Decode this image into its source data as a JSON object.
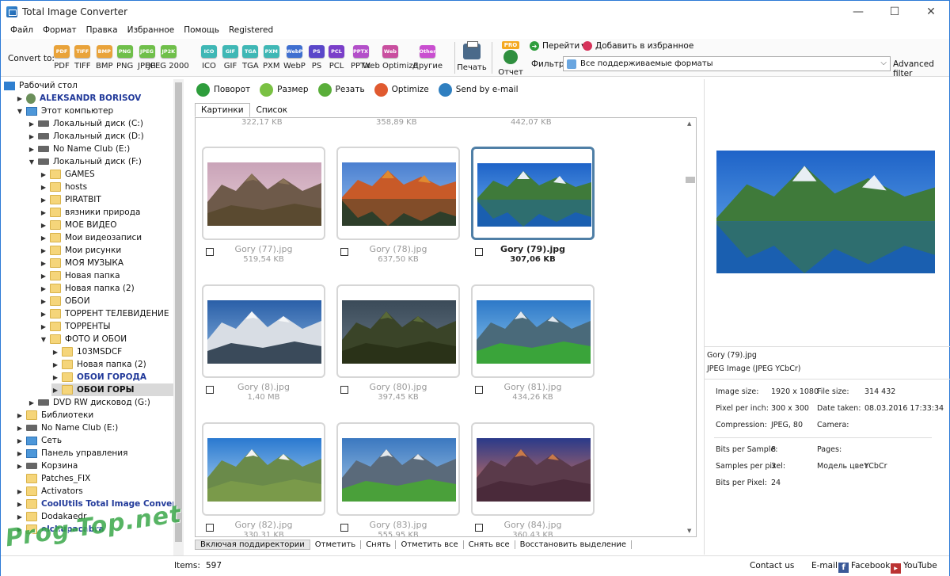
{
  "window": {
    "title": "Total Image Converter"
  },
  "menu": [
    "Файл",
    "Формат",
    "Правка",
    "Избранное",
    "Помощь",
    "Registered"
  ],
  "toolbar": {
    "convert_to": "Convert to:",
    "formats": [
      {
        "label": "PDF",
        "icon": "PDF",
        "color": "#e9a33a"
      },
      {
        "label": "TIFF",
        "icon": "TIFF",
        "color": "#e9a33a"
      },
      {
        "label": "BMP",
        "icon": "BMP",
        "color": "#e9a33a"
      },
      {
        "label": "PNG",
        "icon": "PNG",
        "color": "#6fbf4a"
      },
      {
        "label": "JPEG",
        "icon": "JPEG",
        "color": "#6fbf4a"
      },
      {
        "label": "JPEG 2000",
        "icon": "JP2K",
        "color": "#6fbf4a"
      },
      {
        "label": "ICO",
        "icon": "ICO",
        "color": "#3fb7b5"
      },
      {
        "label": "GIF",
        "icon": "GIF",
        "color": "#3fb7b5"
      },
      {
        "label": "TGA",
        "icon": "TGA",
        "color": "#3fb7b5"
      },
      {
        "label": "PXM",
        "icon": "PXM",
        "color": "#3fb7b5"
      },
      {
        "label": "WebP",
        "icon": "WebP",
        "color": "#3f6fd0"
      },
      {
        "label": "PS",
        "icon": "PS",
        "color": "#5a47c9"
      },
      {
        "label": "PCL",
        "icon": "PCL",
        "color": "#7a3fc9"
      },
      {
        "label": "PPTX",
        "icon": "PPTX",
        "color": "#b34fc9"
      },
      {
        "label": "Web Optimize",
        "icon": "Web",
        "color": "#c94f9f"
      },
      {
        "label": "Другие",
        "icon": "Other",
        "color": "#c94fd0"
      }
    ],
    "print": "Печать",
    "pro": "PRO",
    "report": "Отчет",
    "goto": "Перейти",
    "favorite": "Добавить в избранное",
    "filter_label": "Фильтр:",
    "filter_value": "Все поддерживаемые форматы",
    "advanced": "Advanced filter"
  },
  "tree": [
    {
      "label": "Рабочий стол",
      "icon": "desktop",
      "arrow": "",
      "indent": 0,
      "style": ""
    },
    {
      "label": "ALEKSANDR BORISOV",
      "icon": "user",
      "arrow": "▶",
      "indent": 1,
      "style": "bold-blue"
    },
    {
      "label": "Этот компьютер",
      "icon": "pc",
      "arrow": "▼",
      "indent": 1,
      "style": ""
    },
    {
      "label": "Локальный диск (C:)",
      "icon": "drive",
      "arrow": "▶",
      "indent": 2,
      "style": ""
    },
    {
      "label": "Локальный диск (D:)",
      "icon": "drive",
      "arrow": "▶",
      "indent": 2,
      "style": ""
    },
    {
      "label": "No Name Club (E:)",
      "icon": "drive",
      "arrow": "▶",
      "indent": 2,
      "style": ""
    },
    {
      "label": "Локальный диск (F:)",
      "icon": "drive",
      "arrow": "▼",
      "indent": 2,
      "style": ""
    },
    {
      "label": "GAMES",
      "icon": "folder",
      "arrow": "▶",
      "indent": 3,
      "style": ""
    },
    {
      "label": "hosts",
      "icon": "folder",
      "arrow": "▶",
      "indent": 3,
      "style": ""
    },
    {
      "label": "PIRATBIT",
      "icon": "folder",
      "arrow": "▶",
      "indent": 3,
      "style": ""
    },
    {
      "label": "вязники природа",
      "icon": "folder",
      "arrow": "▶",
      "indent": 3,
      "style": ""
    },
    {
      "label": "МОЕ ВИДЕО",
      "icon": "folder",
      "arrow": "▶",
      "indent": 3,
      "style": ""
    },
    {
      "label": "Мои видеозаписи",
      "icon": "folder",
      "arrow": "▶",
      "indent": 3,
      "style": ""
    },
    {
      "label": "Мои рисунки",
      "icon": "folder",
      "arrow": "▶",
      "indent": 3,
      "style": ""
    },
    {
      "label": "МОЯ МУЗЫКА",
      "icon": "folder",
      "arrow": "▶",
      "indent": 3,
      "style": ""
    },
    {
      "label": "Новая папка",
      "icon": "folder",
      "arrow": "▶",
      "indent": 3,
      "style": ""
    },
    {
      "label": "Новая папка (2)",
      "icon": "folder",
      "arrow": "▶",
      "indent": 3,
      "style": ""
    },
    {
      "label": "ОБОИ",
      "icon": "folder",
      "arrow": "▶",
      "indent": 3,
      "style": ""
    },
    {
      "label": "ТОРРЕНТ ТЕЛЕВИДЕНИЕ",
      "icon": "folder",
      "arrow": "▶",
      "indent": 3,
      "style": ""
    },
    {
      "label": "ТОРРЕНТЫ",
      "icon": "folder",
      "arrow": "▶",
      "indent": 3,
      "style": ""
    },
    {
      "label": "ФОТО И ОБОИ",
      "icon": "folder",
      "arrow": "▼",
      "indent": 3,
      "style": ""
    },
    {
      "label": "103MSDCF",
      "icon": "folder",
      "arrow": "▶",
      "indent": 4,
      "style": ""
    },
    {
      "label": "Новая папка (2)",
      "icon": "folder",
      "arrow": "▶",
      "indent": 4,
      "style": ""
    },
    {
      "label": "ОБОИ ГОРОДА",
      "icon": "folder",
      "arrow": "▶",
      "indent": 4,
      "style": "bold-blue"
    },
    {
      "label": "ОБОИ ГОРЫ",
      "icon": "folder",
      "arrow": "▶",
      "indent": 4,
      "style": "bold",
      "selected": true
    },
    {
      "label": "DVD RW дисковод (G:)",
      "icon": "drive",
      "arrow": "▶",
      "indent": 2,
      "style": ""
    },
    {
      "label": "Библиотеки",
      "icon": "folder",
      "arrow": "▶",
      "indent": 1,
      "style": ""
    },
    {
      "label": "No Name Club (E:)",
      "icon": "drive",
      "arrow": "▶",
      "indent": 1,
      "style": ""
    },
    {
      "label": "Сеть",
      "icon": "pc",
      "arrow": "▶",
      "indent": 1,
      "style": ""
    },
    {
      "label": "Панель управления",
      "icon": "pc",
      "arrow": "▶",
      "indent": 1,
      "style": ""
    },
    {
      "label": "Корзина",
      "icon": "drive",
      "arrow": "▶",
      "indent": 1,
      "style": ""
    },
    {
      "label": "Patches_FIX",
      "icon": "folder",
      "arrow": "",
      "indent": 1,
      "style": ""
    },
    {
      "label": "Activators",
      "icon": "folder",
      "arrow": "▶",
      "indent": 1,
      "style": ""
    },
    {
      "label": "CoolUtils Total Image Converter",
      "icon": "folder",
      "arrow": "▶",
      "indent": 1,
      "style": "bold-blue"
    },
    {
      "label": "Dodakaedr",
      "icon": "folder",
      "arrow": "▶",
      "indent": 1,
      "style": ""
    },
    {
      "label": "elchupacabra",
      "icon": "folder",
      "arrow": "▶",
      "indent": 1,
      "style": "bold-blue"
    }
  ],
  "actions": [
    {
      "label": "Поворот",
      "color": "#2e9d3c"
    },
    {
      "label": "Размер",
      "color": "#7ac143"
    },
    {
      "label": "Резать",
      "color": "#5aae3a"
    },
    {
      "label": "Optimize",
      "color": "#e05a30"
    },
    {
      "label": "Send by e-mail",
      "color": "#2f7fc0"
    }
  ],
  "tabs": [
    "Картинки",
    "Список"
  ],
  "top_sizes": [
    "322,17 KB",
    "358,89 KB",
    "442,07 KB"
  ],
  "images": [
    {
      "name": "Gory (77).jpg",
      "size": "519,54 KB",
      "palette": "alpine-dusk",
      "selected": false
    },
    {
      "name": "Gory (78).jpg",
      "size": "637,50 KB",
      "palette": "autumn-lake",
      "selected": false
    },
    {
      "name": "Gory (79).jpg",
      "size": "307,06 KB",
      "palette": "blue-lake",
      "selected": true
    },
    {
      "name": "Gory (8).jpg",
      "size": "1,40 MB",
      "palette": "snow-peaks",
      "selected": false
    },
    {
      "name": "Gory (80).jpg",
      "size": "397,45 KB",
      "palette": "dark-valley",
      "selected": false
    },
    {
      "name": "Gory (81).jpg",
      "size": "434,26 KB",
      "palette": "green-meadow",
      "selected": false
    },
    {
      "name": "Gory (82).jpg",
      "size": "330,31 KB",
      "palette": "sky-ridge",
      "selected": false
    },
    {
      "name": "Gory (83).jpg",
      "size": "555,95 KB",
      "palette": "spring-alps",
      "selected": false
    },
    {
      "name": "Gory (84).jpg",
      "size": "360,43 KB",
      "palette": "sunset-canyon",
      "selected": false
    }
  ],
  "bottom_actions": [
    "Включая поддиректории",
    "Отметить",
    "Снять",
    "Отметить все",
    "Снять все",
    "Восстановить выделение"
  ],
  "preview": {
    "filename": "Gory (79).jpg",
    "type": "JPEG Image (JPEG YCbCr)",
    "rows": [
      [
        "Image size:",
        "1920 x 1080",
        "File size:",
        "314 432"
      ],
      [
        "Pixel per inch:",
        "300 x 300",
        "Date taken:",
        "08.03.2016 17:33:34"
      ],
      [
        "Compression:",
        "JPEG, 80",
        "Camera:",
        ""
      ]
    ],
    "rows2": [
      [
        "Bits per Sample:",
        "8",
        "Pages:",
        ""
      ],
      [
        "Samples per pixel:",
        "3",
        "Модель цвет",
        "YCbCr"
      ],
      [
        "Bits per Pixel:",
        "24",
        "",
        ""
      ]
    ]
  },
  "status": {
    "items_label": "Items:",
    "items_count": "597",
    "contact": "Contact us",
    "email": "E-mail",
    "facebook": "Facebook",
    "youtube": "YouTube",
    "watermark": "Prog-Top.net"
  }
}
